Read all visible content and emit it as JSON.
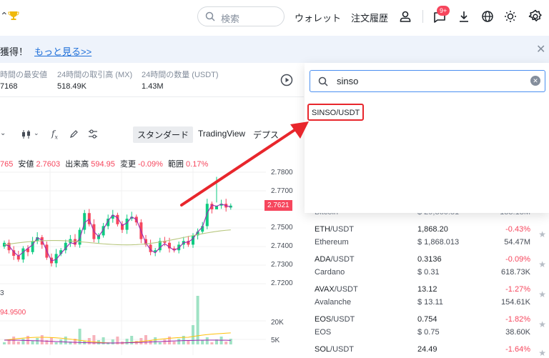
{
  "header": {
    "search_placeholder": "検索",
    "wallet": "ウォレット",
    "orders": "注文履歴",
    "notification_badge": "9+"
  },
  "notice": {
    "text": "獲得！",
    "link": "もっと見る>>"
  },
  "stats": [
    {
      "label": "時間の最安値",
      "value": "7168"
    },
    {
      "label": "24時間の取引高 (MX)",
      "value": "518.49K"
    },
    {
      "label": "24時間の数量 (USDT)",
      "value": "1.43M"
    }
  ],
  "chart": {
    "tabs": [
      "スタンダード",
      "TradingView",
      "デプス"
    ],
    "ohlc": {
      "open_value": "765",
      "low_label": "安値",
      "low_value": "2.7603",
      "vol_label": "出来高",
      "vol_value": "594.95",
      "chg_label": "変更",
      "chg_value": "-0.09%",
      "range_label": "範囲",
      "range_value": "0.17%"
    },
    "price_ticks": [
      "2.7800",
      "2.7700",
      "2.7500",
      "2.7400",
      "2.7300",
      "2.7200"
    ],
    "current_price": "2.7621",
    "volume_ticks": [
      "20K",
      "5K"
    ],
    "volume_readout": "94.9500",
    "left_small": "3"
  },
  "search": {
    "query": "sinso",
    "result": "SINSO/USDT"
  },
  "market_list": {
    "partial_top": {
      "name": "Bitcoin",
      "usd": "$ 29,360.81",
      "vol": "133.13M"
    },
    "rows": [
      {
        "base": "ETH",
        "quote": "/USDT",
        "name": "Ethereum",
        "price": "1,868.20",
        "usd": "$ 1,868.013",
        "change": "-0.43%",
        "vol": "54.47M"
      },
      {
        "base": "ADA",
        "quote": "/USDT",
        "name": "Cardano",
        "price": "0.3136",
        "usd": "$ 0.31",
        "change": "-0.09%",
        "vol": "618.73K"
      },
      {
        "base": "AVAX",
        "quote": "/USDT",
        "name": "Avalanche",
        "price": "13.12",
        "usd": "$ 13.11",
        "change": "-1.27%",
        "vol": "154.61K"
      },
      {
        "base": "EOS",
        "quote": "/USDT",
        "name": "EOS",
        "price": "0.754",
        "usd": "$ 0.75",
        "change": "-1.82%",
        "vol": "38.60K"
      },
      {
        "base": "SOL",
        "quote": "/USDT",
        "name": "",
        "price": "24.49",
        "usd": "",
        "change": "-1.64%",
        "vol": ""
      }
    ]
  },
  "colors": {
    "up": "#0ecb81",
    "down": "#f6465d",
    "accent": "#1e6fd9",
    "annotation": "#e8262c"
  }
}
